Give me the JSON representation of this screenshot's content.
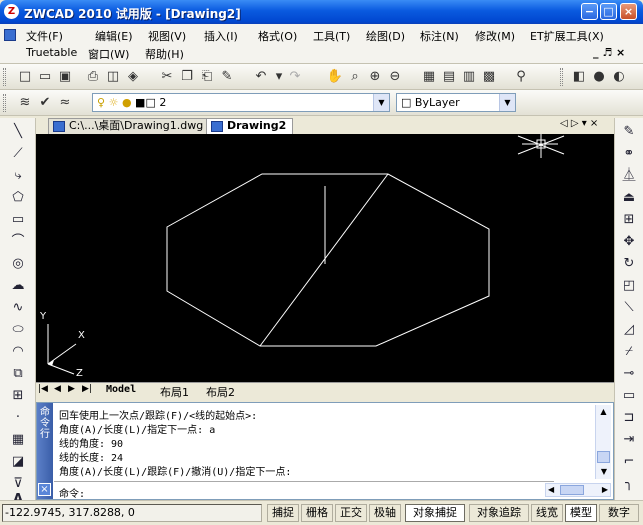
{
  "window": {
    "title": "ZWCAD 2010 试用版 - [Drawing2]",
    "min": "−",
    "max": "□",
    "close": "×"
  },
  "menu": {
    "row1": [
      "文件(F)",
      "编辑(E)",
      "视图(V)",
      "插入(I)",
      "格式(O)",
      "工具(T)",
      "绘图(D)",
      "标注(N)",
      "修改(M)",
      "ET扩展工具(X)"
    ],
    "row2": [
      "Truetable",
      "窗口(W)",
      "帮助(H)"
    ],
    "doc_controls": "_ ♬ ×"
  },
  "layer": {
    "current": "2",
    "linetype": "ByLayer"
  },
  "doc_tabs": [
    {
      "label": "C:\\...\\桌面\\Drawing1.dwg"
    },
    {
      "label": "Drawing2"
    }
  ],
  "tab_nav": "◁ ▷ ▾ ×",
  "ucs": {
    "y": "Y",
    "x": "X",
    "z": "Z"
  },
  "layout_tabs": [
    "Model",
    "布局1",
    "布局2"
  ],
  "layout_nav": [
    "|◀",
    "◀",
    "▶",
    "▶|"
  ],
  "command": {
    "side_label": "命令行",
    "lines": [
      "回车使用上一次点/跟踪(F)/<线的起始点>:",
      "角度(A)/长度(L)/指定下一点: a",
      "线的角度: 90",
      "线的长度: 24",
      "角度(A)/长度(L)/跟踪(F)/撤消(U)/指定下一点:"
    ],
    "prompt": "命令:"
  },
  "status": {
    "coords": "-122.9745,  317.8288,  0",
    "buttons": [
      "捕捉",
      "栅格",
      "正交",
      "极轴",
      "对象捕捉",
      "对象追踪",
      "线宽",
      "模型",
      "数字"
    ],
    "active": [
      "对象捕捉",
      "模型"
    ]
  },
  "icons": [
    "app-icon",
    "new-icon",
    "open-icon",
    "save-icon",
    "print-icon",
    "cut-icon",
    "copy-icon",
    "paste-icon",
    "undo-icon",
    "redo-icon",
    "zoom-icon",
    "pan-icon",
    "line-icon",
    "circle-icon",
    "arc-icon",
    "move-icon",
    "rotate-icon"
  ]
}
